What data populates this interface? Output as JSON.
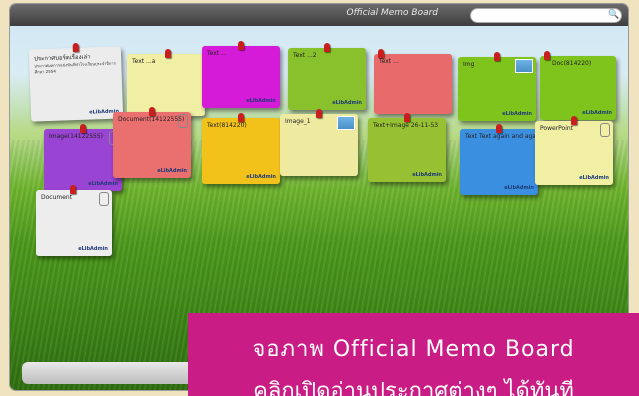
{
  "board": {
    "title": "Official Memo Board",
    "search_placeholder": ""
  },
  "notes": [
    {
      "title": "ประกาศบอร์ดเรื่องเล่า",
      "body": "ประกาศผลการแข่งขันกีฬาโรงเรียนประจำปีการศึกษา 2554",
      "author": "eLibAdmin",
      "color": "#ececec"
    },
    {
      "title": "Text ...a",
      "body": "",
      "author": "",
      "color": "#f1efa4"
    },
    {
      "title": "Text ...",
      "body": "",
      "author": "eLibAdmin",
      "color": "#d51bd8"
    },
    {
      "title": "Text ...2",
      "body": "",
      "author": "eLibAdmin",
      "color": "#88c12c"
    },
    {
      "title": "Text ...",
      "body": "",
      "author": "",
      "color": "#e86a6a"
    },
    {
      "title": "Img",
      "body": "",
      "author": "eLibAdmin",
      "color": "#7fc41c"
    },
    {
      "title": "Doc(814220)",
      "body": "",
      "author": "eLibAdmin",
      "color": "#7fc41c"
    },
    {
      "title": "Image(14122555)",
      "body": "",
      "author": "eLibAdmin",
      "color": "#9a44d3"
    },
    {
      "title": "Document(14122555)",
      "body": "",
      "author": "eLibAdmin",
      "color": "#ea6f6f"
    },
    {
      "title": "Text(814220)",
      "body": "",
      "author": "eLibAdmin",
      "color": "#f3c21a"
    },
    {
      "title": "Image_1",
      "body": "",
      "author": "",
      "color": "#eeeaa0"
    },
    {
      "title": "Text+Image 26-11-53",
      "body": "",
      "author": "eLibAdmin",
      "color": "#97c132"
    },
    {
      "title": "Text Text again and again",
      "body": "",
      "author": "eLibAdmin",
      "color": "#3b8fe0"
    },
    {
      "title": "PowerPoint",
      "body": "",
      "author": "eLibAdmin",
      "color": "#f1efa4"
    },
    {
      "title": "Document",
      "body": "",
      "author": "eLibAdmin",
      "color": "#ededed"
    }
  ],
  "caption": {
    "line1": "จอภาพ Official Memo Board",
    "line2": "คลิกเปิดอ่านประกาศต่างๆ ได้ทันที"
  }
}
